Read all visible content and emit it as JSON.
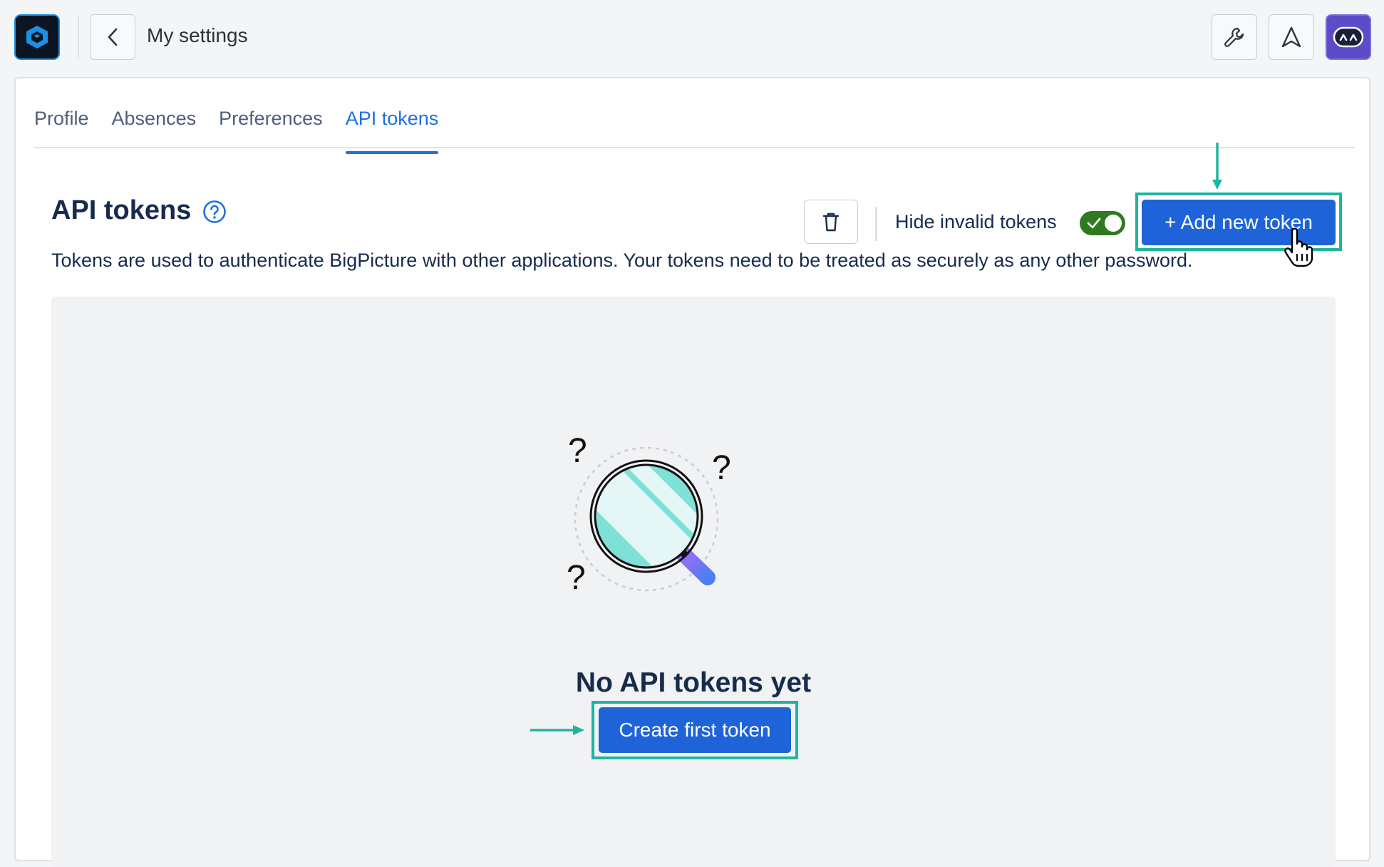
{
  "header": {
    "logo_icon": "app-logo-icon",
    "back_icon": "chevron-left-icon",
    "title": "My settings",
    "tools_icon": "wrench-icon",
    "notifications_icon": "navigation-arrow-icon",
    "avatar_icon": "user-avatar-icon"
  },
  "tabs": [
    {
      "label": "Profile",
      "active": false
    },
    {
      "label": "Absences",
      "active": false
    },
    {
      "label": "Preferences",
      "active": false
    },
    {
      "label": "API tokens",
      "active": true
    }
  ],
  "section": {
    "title": "API tokens",
    "help_icon": "question-circle-icon",
    "description": "Tokens are used to authenticate BigPicture with other applications. Your tokens need to be treated as securely as any other password."
  },
  "toolbar": {
    "delete_icon": "trash-icon",
    "hide_invalid_label": "Hide invalid tokens",
    "hide_invalid_enabled": true,
    "add_button_label": "+ Add new token"
  },
  "empty_state": {
    "illustration_icon": "magnifier-question-icon",
    "title": "No API tokens yet",
    "button_label": "Create first token"
  },
  "colors": {
    "accent": "#1f63d8",
    "tab_active": "#1f6fe0",
    "toggle_on": "#2f7a21",
    "highlight": "#1fb5a0"
  }
}
